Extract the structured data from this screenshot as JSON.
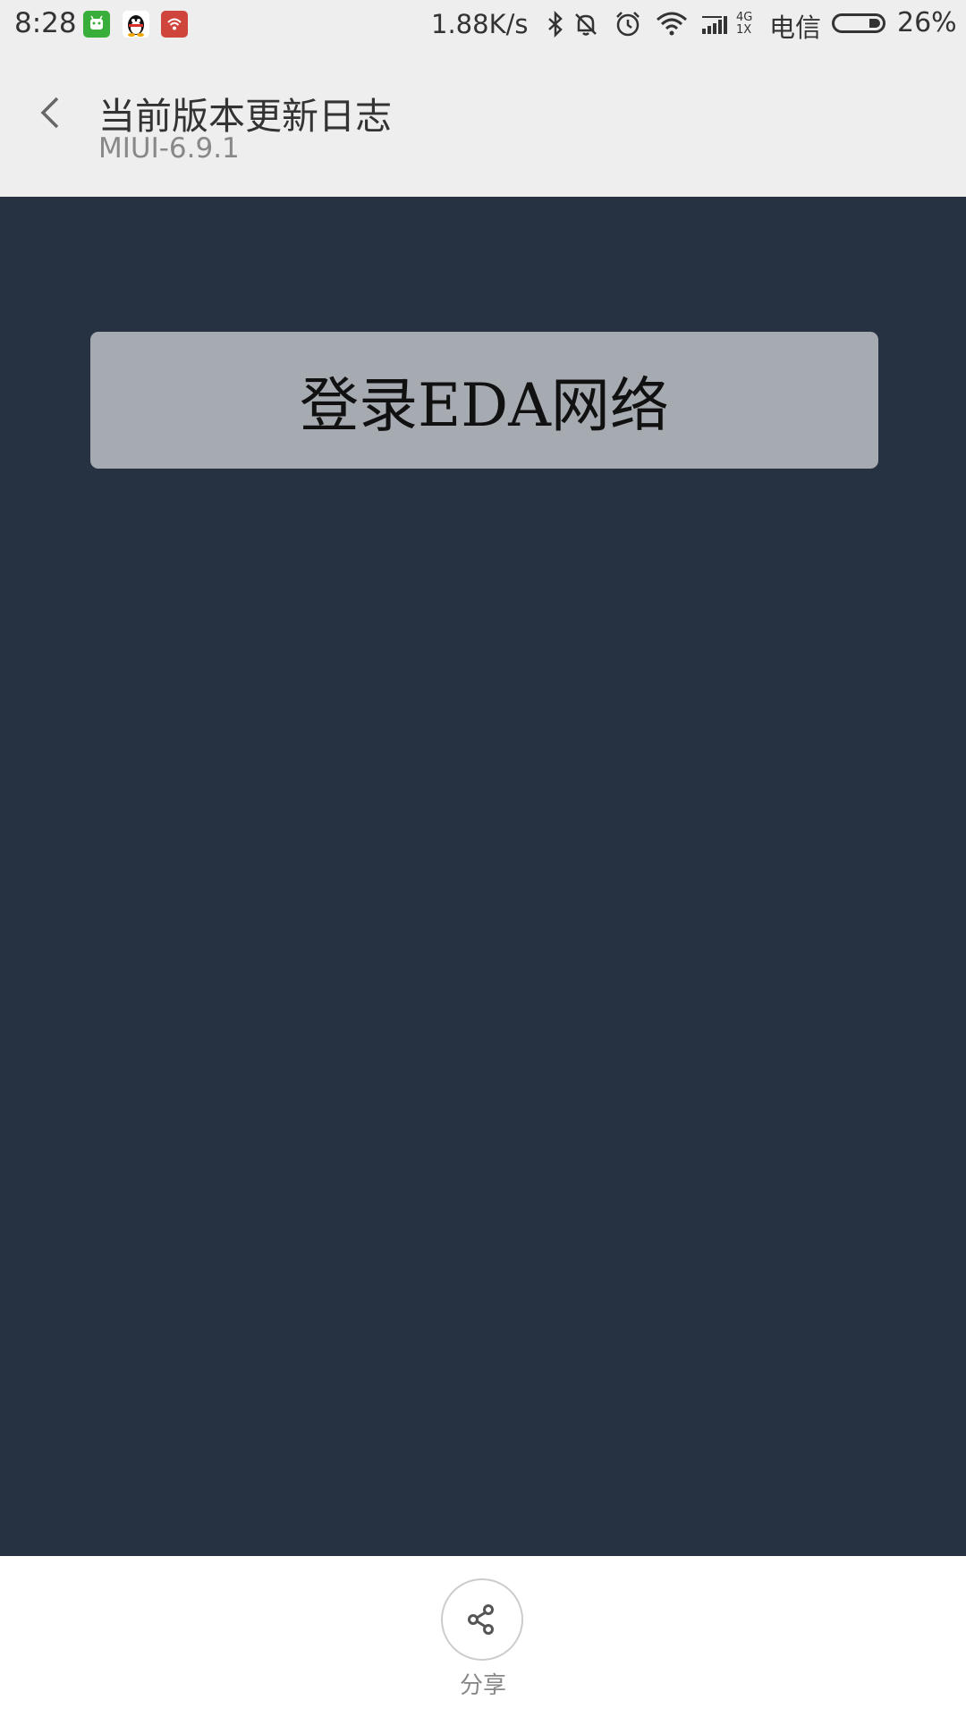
{
  "status_bar": {
    "time": "8:28",
    "network_speed": "1.88K/s",
    "carrier": "电信",
    "battery_percent": "26%",
    "battery_level": 0.26,
    "notification_icons": [
      "green-app-icon",
      "qq-icon",
      "wifi-hotspot-app-icon"
    ],
    "system_icons": [
      "bluetooth-icon",
      "mute-icon",
      "alarm-icon",
      "wifi-icon",
      "signal-icon",
      "4g-1x-icon",
      "battery-icon"
    ],
    "network_type_top": "4G",
    "network_type_bottom": "1X"
  },
  "header": {
    "title": "当前版本更新日志",
    "subtitle": "MIUI-6.9.1"
  },
  "main": {
    "login_button_label": "登录EDA网络"
  },
  "footer": {
    "share_label": "分享"
  },
  "colors": {
    "header_background": "#eeeeee",
    "content_background": "#263242",
    "login_button_background": "#a6abb2",
    "footer_background": "#ffffff"
  }
}
